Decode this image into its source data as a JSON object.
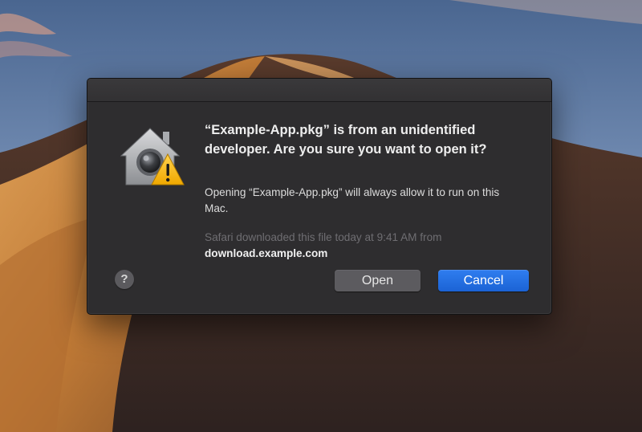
{
  "dialog": {
    "headline": "“Example-App.pkg”  is from an unidentified developer. Are you sure you want to open it?",
    "info": "Opening “Example-App.pkg” will always allow it to run on this Mac.",
    "source_text": "Safari downloaded this file today at 9:41 AM from",
    "source_domain": "download.example.com",
    "help_label": "?",
    "open_label": "Open",
    "cancel_label": "Cancel",
    "icons": {
      "app": "gatekeeper-house-warning-icon"
    }
  },
  "colors": {
    "dialog_bg": "#2e2d2f",
    "accent_blue": "#2f7df0",
    "secondary_button": "#5c5b5f",
    "muted_text": "#6f6e72"
  }
}
